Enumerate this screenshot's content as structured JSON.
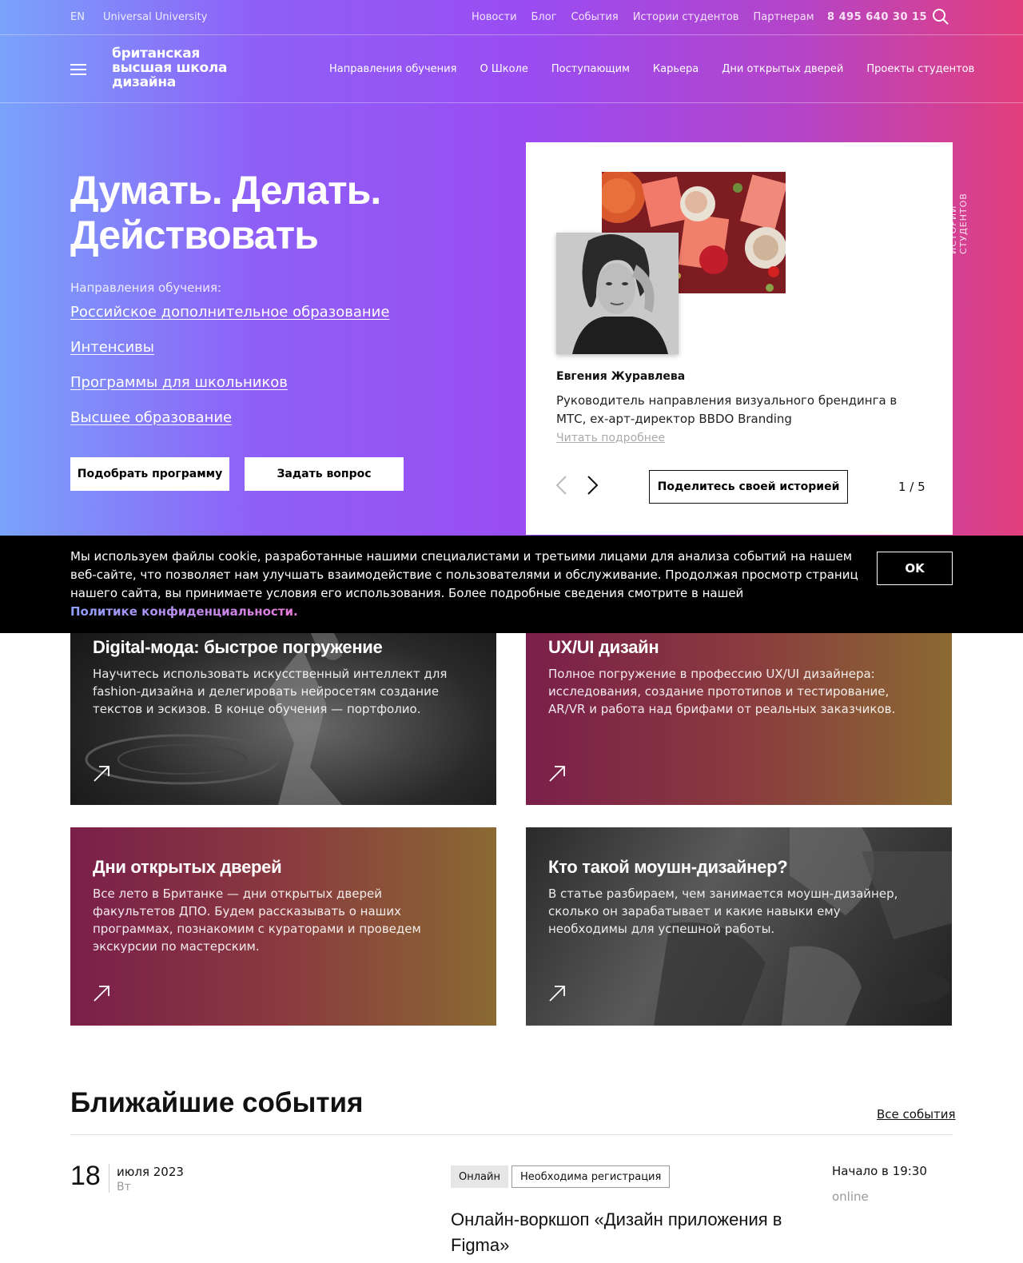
{
  "topbar": {
    "lang": "EN",
    "university": "Universal University",
    "links": [
      "Новости",
      "Блог",
      "События",
      "Истории студентов",
      "Партнерам"
    ],
    "phone": "8 495 640 30 15"
  },
  "logo": {
    "line1": "британская",
    "line2": "высшая школа",
    "line3": "дизайна"
  },
  "nav": {
    "links": [
      "Направления обучения",
      "О Школе",
      "Поступающим",
      "Карьера",
      "Дни открытых дверей",
      "Проекты студентов"
    ]
  },
  "hero": {
    "title_line1": "Думать. Делать.",
    "title_line2": "Действовать",
    "directions_label": "Направления обучения:",
    "directions": [
      "Российское дополнительное образование",
      "Интенсивы",
      "Программы для школьников",
      "Высшее образование"
    ],
    "btn_pick": "Подобрать программу",
    "btn_ask": "Задать вопрос"
  },
  "story": {
    "vertical_label": "ИСТОРИИ СТУДЕНТОВ",
    "name": "Евгения Журавлева",
    "description": "Руководитель направления визуального брендинга в МТС, ex-арт-директор BBDO Branding",
    "read_more": "Читать подробнее",
    "share_button": "Поделитесь своей историей",
    "counter": "1 / 5"
  },
  "cookie": {
    "text": "Мы используем файлы cookie, разработанные нашими специалистами и третьими лицами для анализа событий на нашем веб-сайте, что позволяет нам улучшать взаимодействие с пользователями и обслуживание. Продолжая просмотр страниц нашего сайта, вы принимаете условия его использования. Более подробные сведения смотрите в нашей ",
    "link": "Политике конфиденциальности.",
    "ok": "OK"
  },
  "cards": [
    {
      "title": "Digital-мода: быстрое погружение",
      "description": "Научитесь использовать искусственный интеллект для fashion-дизайна и делегировать нейросетям создание текстов и эскизов. В конце обучения — портфолио."
    },
    {
      "title": "UX/UI дизайн",
      "description": "Полное погружение в профессию UX/UI дизайнера: исследования, создание прототипов и тестирование, AR/VR и работа над брифами от реальных заказчиков."
    },
    {
      "title": "Дни открытых дверей",
      "description": "Все лето в Британке — дни открытых дверей факультетов ДПО. Будем рассказывать о наших программах, познакомим с кураторами и проведем экскурсии по мастерским."
    },
    {
      "title": "Кто такой моушн-дизайнер?",
      "description": "В статье разбираем, чем занимается моушн-дизайнер, сколько он зарабатывает и какие навыки ему необходимы для успешной работы."
    }
  ],
  "events": {
    "title": "Ближайшие события",
    "all_link": "Все события",
    "items": [
      {
        "day": "18",
        "month_year": "июля 2023",
        "weekday": "Вт",
        "tag_online": "Онлайн",
        "tag_registration": "Необходима регистрация",
        "title": "Онлайн-воркшоп «Дизайн приложения в Figma»",
        "start": "Начало в 19:30",
        "place": "online"
      }
    ]
  },
  "colors": {
    "gradient_left": "#79a3fb",
    "gradient_mid": "#9a4cf2",
    "gradient_right": "#e23f7c",
    "card_warm_left": "#7a1f4a",
    "card_warm_right": "#8a6a32"
  }
}
